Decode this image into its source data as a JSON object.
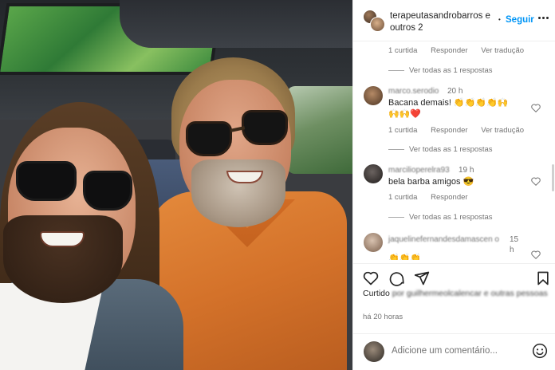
{
  "header": {
    "username": "terapeutasandrobarros e outros 2",
    "dot": "•",
    "follow_label": "Seguir"
  },
  "comments": [
    {
      "id": "c0",
      "likes": "1 curtida",
      "reply": "Responder",
      "translate": "Ver tradução",
      "view_replies": "Ver todas as 1 respostas"
    },
    {
      "id": "c1",
      "user": "marco.serodio",
      "time": "20 h",
      "text": "Bacana demais! 👏👏👏👏🙌🙌🙌❤️",
      "likes": "1 curtida",
      "reply": "Responder",
      "translate": "Ver tradução",
      "view_replies": "Ver todas as 1 respostas"
    },
    {
      "id": "c2",
      "user": "marcilioperelra93",
      "time": "19 h",
      "text": "bela barba amigos 😎",
      "likes": "1 curtida",
      "reply": "Responder",
      "view_replies": "Ver todas as 1 respostas"
    },
    {
      "id": "c3",
      "user": "jaquelinefernandesdamascen o",
      "time": "15 h",
      "text": "👏👏👏"
    }
  ],
  "actions": {
    "icons": [
      "heart-icon",
      "comment-icon",
      "share-icon",
      "bookmark-icon"
    ]
  },
  "likes_line": {
    "prefix": "Curtido",
    "blurred": "por guilhermeolcalencar e outras pessoas"
  },
  "timestamp": "há 20 horas",
  "add_comment": {
    "placeholder": "Adicione um comentário..."
  },
  "colors": {
    "accent": "#0095f6",
    "text": "#262626",
    "muted": "#737373",
    "heart": "#ed4956"
  }
}
